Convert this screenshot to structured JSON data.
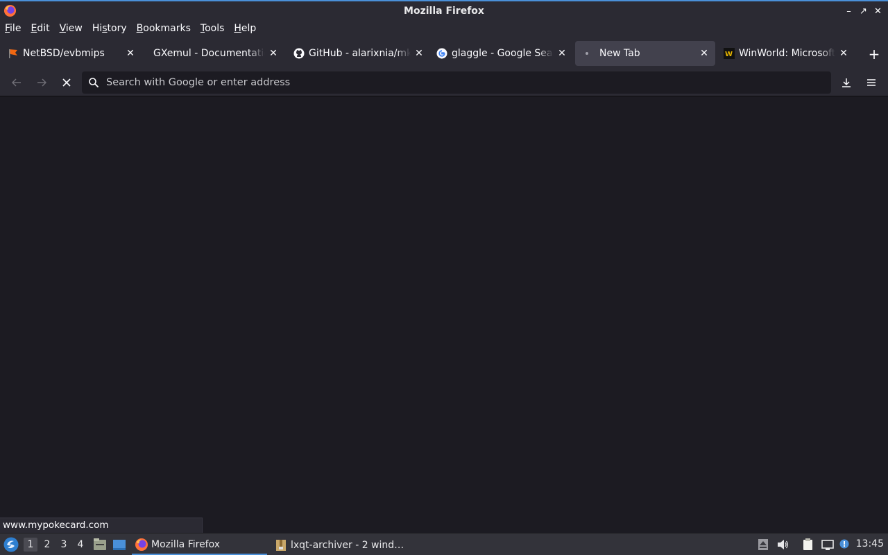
{
  "window": {
    "title": "Mozilla Firefox"
  },
  "menu": [
    {
      "label": "File",
      "key": "F",
      "rest": "ile"
    },
    {
      "label": "Edit",
      "key": "E",
      "rest": "dit"
    },
    {
      "label": "View",
      "key": "V",
      "rest": "iew"
    },
    {
      "label": "History",
      "pre": "Hi",
      "key": "s",
      "rest": "tory"
    },
    {
      "label": "Bookmarks",
      "key": "B",
      "rest": "ookmarks"
    },
    {
      "label": "Tools",
      "key": "T",
      "rest": "ools"
    },
    {
      "label": "Help",
      "key": "H",
      "rest": "elp"
    }
  ],
  "tabs": [
    {
      "label": "NetBSD/evbmips",
      "icon": "netbsd-flag-icon",
      "selected": false
    },
    {
      "label": "GXemul - Documentation",
      "icon": "none",
      "selected": false
    },
    {
      "label": "GitHub - alarixnia/mkimg",
      "icon": "github-icon",
      "selected": false
    },
    {
      "label": "glaggle - Google Search",
      "icon": "google-icon",
      "selected": false
    },
    {
      "label": "New Tab",
      "icon": "loading-dot-icon",
      "selected": true
    },
    {
      "label": "WinWorld: Microsoft Windows",
      "icon": "winworld-icon",
      "selected": false
    }
  ],
  "urlbar": {
    "placeholder": "Search with Google or enter address",
    "value": ""
  },
  "status": {
    "text": "www.mypokecard.com"
  },
  "taskbar": {
    "desktops": [
      "1",
      "2",
      "3",
      "4"
    ],
    "current_desktop": "1",
    "tasks": [
      {
        "label": "Mozilla Firefox",
        "active": true
      },
      {
        "label": "lxqt-archiver - 2 wind…",
        "active": false
      }
    ],
    "clock": "13:45"
  },
  "colors": {
    "accent": "#4a90d9",
    "chrome": "#2b2a33",
    "content": "#1c1b22",
    "selected_tab": "#42414d"
  }
}
